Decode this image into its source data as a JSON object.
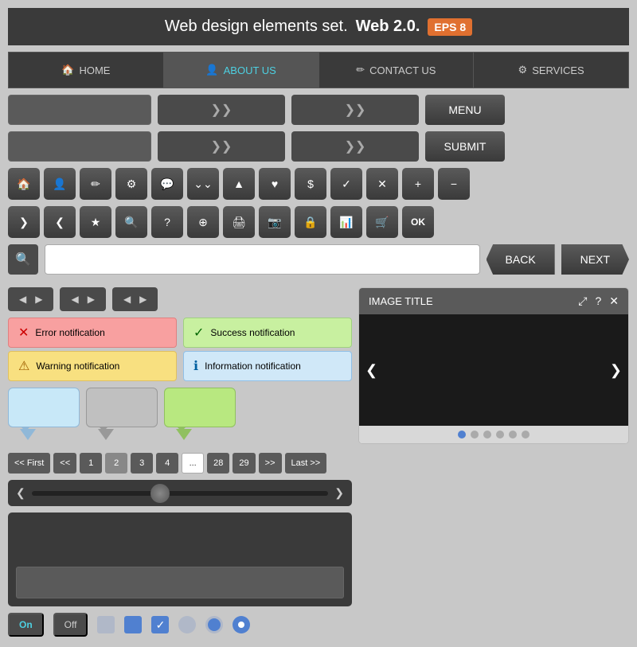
{
  "header": {
    "title_normal": "Web design elements set.",
    "title_bold": "Web 2.0.",
    "eps_badge": "EPS 8"
  },
  "nav": {
    "items": [
      {
        "label": "HOME",
        "icon": "🏠",
        "active": false
      },
      {
        "label": "ABOUT US",
        "icon": "👤",
        "active": true
      },
      {
        "label": "CONTACT US",
        "icon": "✏",
        "active": false
      },
      {
        "label": "SERVICES",
        "icon": "⚙",
        "active": false
      }
    ]
  },
  "row1": {
    "placeholder": "",
    "dropdown1_icon": "❯❯",
    "dropdown2_icon": "❯❯",
    "menu_btn": "MENU"
  },
  "row2": {
    "dropdown1_icon": "❯❯",
    "dropdown2_icon": "❯❯",
    "submit_btn": "SUBMIT"
  },
  "search": {
    "back_btn": "BACK",
    "next_btn": "NEXT"
  },
  "notifications": {
    "error": "Error notification",
    "success": "Success notification",
    "warning": "Warning notification",
    "info": "Information notification"
  },
  "pagination": {
    "first": "<< First",
    "prev": "<<",
    "pages": [
      "1",
      "2",
      "3",
      "4"
    ],
    "dots": "...",
    "near_last": [
      "28",
      "29"
    ],
    "next": ">>",
    "last": "Last >>"
  },
  "image_panel": {
    "title": "IMAGE TITLE",
    "dots_count": 6,
    "active_dot": 1
  },
  "toggles": {
    "on_label": "On",
    "off_label": "Off"
  },
  "icons": {
    "home": "🏠",
    "user": "👤",
    "edit": "✏",
    "gear": "⚙",
    "chat": "💬",
    "chevron_down": "❯❯",
    "chevron_up": "❮❮",
    "heart": "♥",
    "dollar": "$",
    "check": "✓",
    "cross": "✕",
    "plus": "+",
    "minus": "−",
    "forward": "❯",
    "back": "❮",
    "star": "★",
    "search": "🔍",
    "question": "?",
    "rss": "⊕",
    "print": "🖨",
    "camera": "📷",
    "lock": "🔒",
    "chart": "📊",
    "cart": "🛒",
    "ok": "OK",
    "search_small": "🔍"
  }
}
